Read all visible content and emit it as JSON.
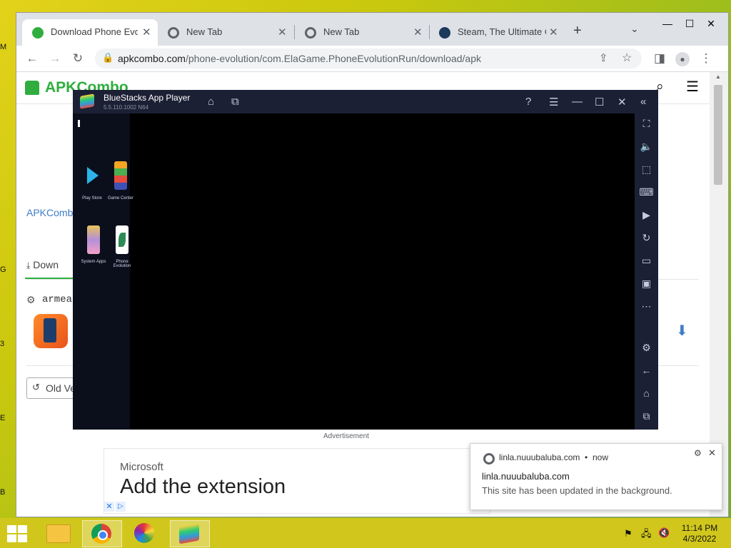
{
  "browser": {
    "tabs": [
      {
        "title": "Download Phone Evolut",
        "active": true
      },
      {
        "title": "New Tab",
        "active": false
      },
      {
        "title": "New Tab",
        "active": false
      },
      {
        "title": "Steam, The Ultimate O",
        "active": false
      }
    ],
    "url_host": "apkcombo.com",
    "url_path": "/phone-evolution/com.ElaGame.PhoneEvolutionRun/download/apk",
    "window_controls": {
      "minimize": "—",
      "maximize": "☐",
      "close": "✕"
    }
  },
  "page": {
    "logo": "APKCombo",
    "breadcrumb": "APKCombo",
    "tab_download": "Down",
    "arch_label": "armeab",
    "old_versions": "Old Ve",
    "advertisement": "Advertisement"
  },
  "ad": {
    "brand": "Microsoft",
    "headline": "Add the extension"
  },
  "notification": {
    "source": "linla.nuuubaluba.com",
    "time": "now",
    "title": "linla.nuuubaluba.com",
    "body": "This site has been updated in the background."
  },
  "bluestacks": {
    "title": "BlueStacks App Player",
    "version": "5.5.110.1002 N64",
    "apps": [
      {
        "label": "Play Store"
      },
      {
        "label": "Game Center"
      },
      {
        "label": "System Apps"
      },
      {
        "label": "Phone Evolution"
      }
    ]
  },
  "taskbar": {
    "time": "11:14 PM",
    "date": "4/3/2022"
  },
  "colors": {
    "apkcombo_green": "#2fae3f",
    "bluestacks_bg": "#1c2034",
    "taskbar": "#d1c71c"
  }
}
